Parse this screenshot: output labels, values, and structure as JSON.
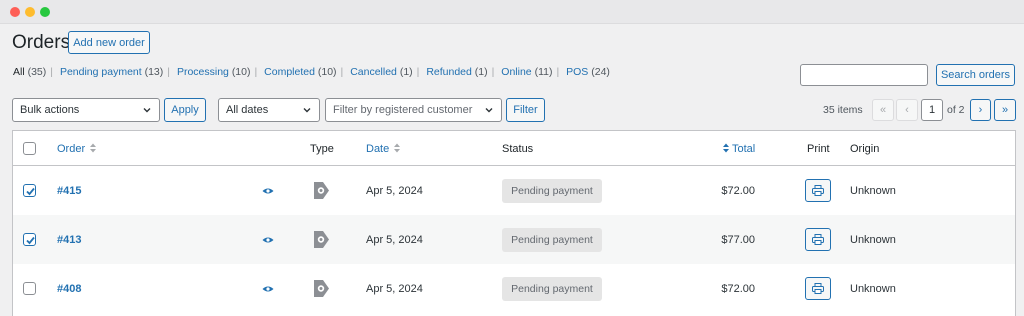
{
  "window": {
    "controls": [
      "close",
      "minimize",
      "zoom"
    ]
  },
  "header": {
    "title": "Orders",
    "add_new_label": "Add new order"
  },
  "status_filters": [
    {
      "label": "All",
      "count": "(35)",
      "current": true
    },
    {
      "label": "Pending payment",
      "count": "(13)"
    },
    {
      "label": "Processing",
      "count": "(10)"
    },
    {
      "label": "Completed",
      "count": "(10)"
    },
    {
      "label": "Cancelled",
      "count": "(1)"
    },
    {
      "label": "Refunded",
      "count": "(1)"
    },
    {
      "label": "Online",
      "count": "(11)"
    },
    {
      "label": "POS",
      "count": "(24)"
    }
  ],
  "search": {
    "value": "",
    "button_label": "Search orders"
  },
  "toolbar": {
    "bulk_actions": "Bulk actions",
    "apply_label": "Apply",
    "dates": "All dates",
    "customer_placeholder": "Filter by registered customer",
    "filter_label": "Filter"
  },
  "pagination": {
    "items": "35 items",
    "first": "«",
    "prev": "‹",
    "current_page": "1",
    "of_label": "of 2",
    "next": "›",
    "last": "»"
  },
  "table": {
    "columns": {
      "order": "Order",
      "type": "Type",
      "date": "Date",
      "status": "Status",
      "total": "Total",
      "print": "Print",
      "origin": "Origin"
    },
    "rows": [
      {
        "order": "#415",
        "date": "Apr 5, 2024",
        "status": "Pending payment",
        "total": "$72.00",
        "origin": "Unknown",
        "checked": true
      },
      {
        "order": "#413",
        "date": "Apr 5, 2024",
        "status": "Pending payment",
        "total": "$77.00",
        "origin": "Unknown",
        "checked": true
      },
      {
        "order": "#408",
        "date": "Apr 5, 2024",
        "status": "Pending payment",
        "total": "$72.00",
        "origin": "Unknown",
        "checked": false
      }
    ]
  },
  "icons": {
    "preview": "eye-icon",
    "type": "pos-tag-icon",
    "print": "printer-icon",
    "sort": "sort-arrows-icon"
  },
  "colors": {
    "link": "#2271b1",
    "status_bg": "#e5e5e5"
  }
}
